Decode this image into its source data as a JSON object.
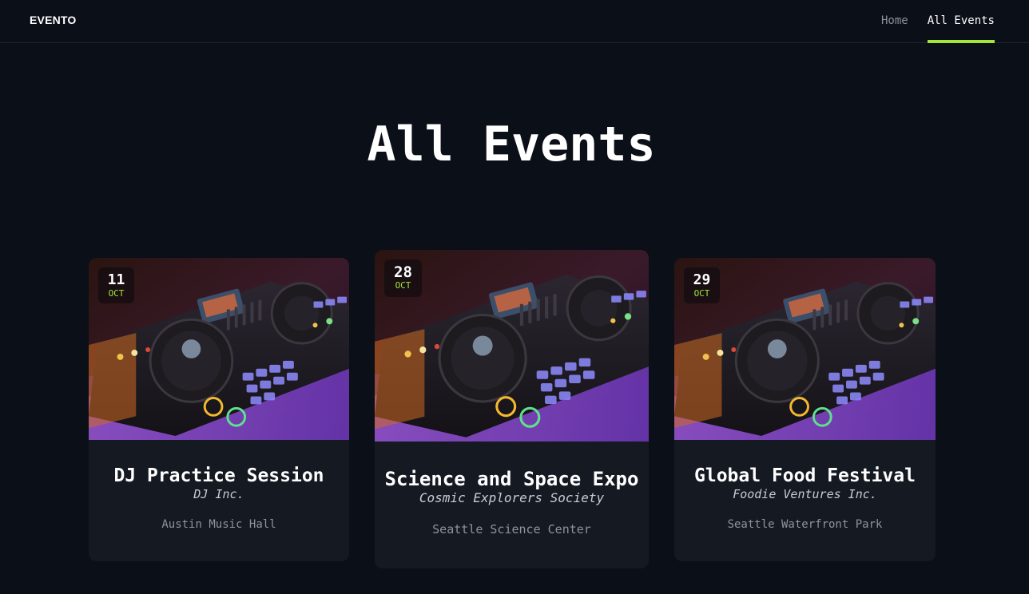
{
  "header": {
    "logo": "EVENTO",
    "nav": [
      {
        "label": "Home",
        "active": false
      },
      {
        "label": "All Events",
        "active": true
      }
    ]
  },
  "page": {
    "title": "All Events"
  },
  "events": [
    {
      "day": "11",
      "month": "OCT",
      "title": "DJ Practice Session",
      "organizer": "DJ Inc.",
      "venue": "Austin Music Hall"
    },
    {
      "day": "28",
      "month": "OCT",
      "title": "Science and Space Expo",
      "organizer": "Cosmic Explorers Society",
      "venue": "Seattle Science Center"
    },
    {
      "day": "29",
      "month": "OCT",
      "title": "Global Food Festival",
      "organizer": "Foodie Ventures Inc.",
      "venue": "Seattle Waterfront Park"
    }
  ],
  "colors": {
    "background": "#0b0f17",
    "card": "#151922",
    "accent": "#a3e635"
  }
}
